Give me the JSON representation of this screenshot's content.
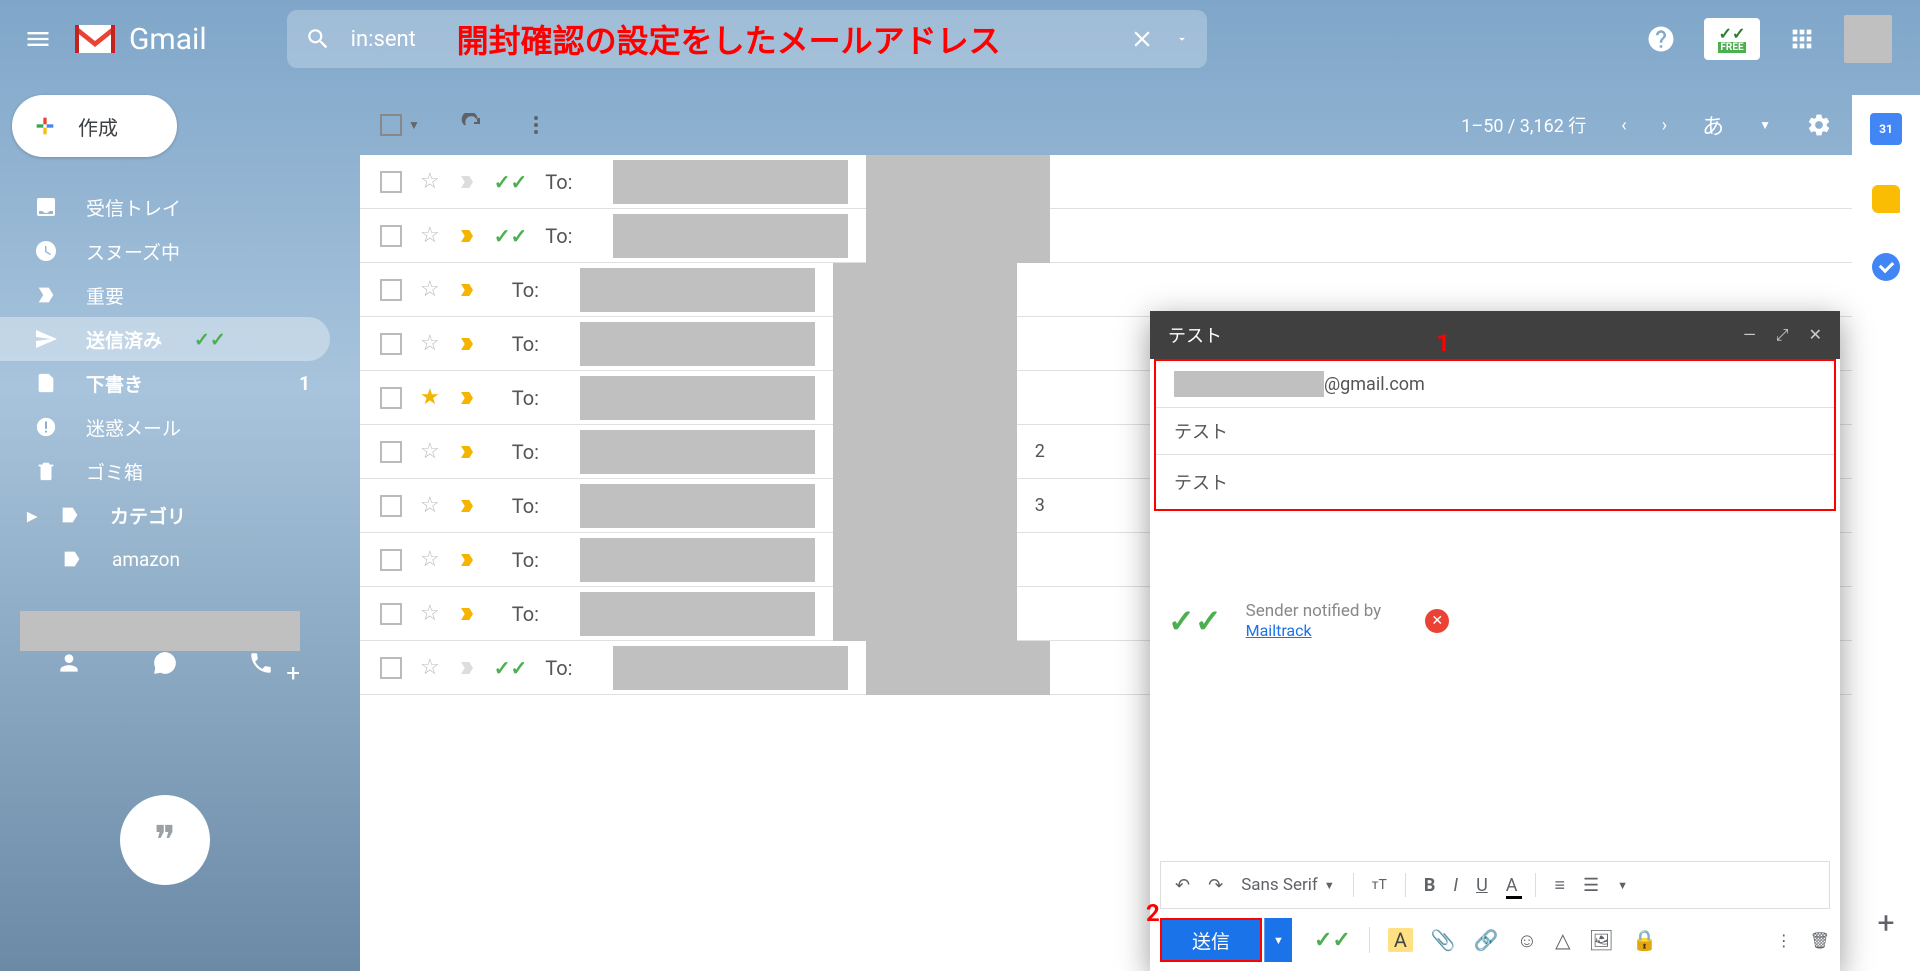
{
  "header": {
    "logo_text": "Gmail",
    "search_value": "in:sent",
    "annotation": "開封確認の設定をしたメールアドレス",
    "mailtrack_free": "FREE"
  },
  "compose_btn": "作成",
  "sidebar": {
    "items": [
      {
        "label": "受信トレイ",
        "icon": "inbox"
      },
      {
        "label": "スヌーズ中",
        "icon": "snooze"
      },
      {
        "label": "重要",
        "icon": "important"
      },
      {
        "label": "送信済み",
        "icon": "send",
        "active": true
      },
      {
        "label": "下書き",
        "icon": "draft",
        "count": "1"
      },
      {
        "label": "迷惑メール",
        "icon": "spam"
      },
      {
        "label": "ゴミ箱",
        "icon": "trash"
      },
      {
        "label": "カテゴリ",
        "icon": "category"
      },
      {
        "label": "amazon",
        "icon": "label"
      }
    ]
  },
  "toolbar": {
    "pagination": "1–50 / 3,162 行",
    "ime": "あ"
  },
  "emails": [
    {
      "to": "To:",
      "track": "green",
      "imp": "gray",
      "star": ""
    },
    {
      "to": "To:",
      "track": "green",
      "imp": "yellow",
      "star": ""
    },
    {
      "to": "To:",
      "track": "",
      "imp": "yellow",
      "star": ""
    },
    {
      "to": "To:",
      "track": "",
      "imp": "yellow",
      "star": ""
    },
    {
      "to": "To:",
      "track": "",
      "imp": "yellow",
      "star": "gold"
    },
    {
      "to": "To:",
      "track": "",
      "imp": "yellow",
      "star": "",
      "num": "2"
    },
    {
      "to": "To:",
      "track": "",
      "imp": "yellow",
      "star": "",
      "num": "3"
    },
    {
      "to": "To:",
      "track": "",
      "imp": "yellow",
      "star": ""
    },
    {
      "to": "To:",
      "track": "",
      "imp": "yellow",
      "star": ""
    },
    {
      "to": "To:",
      "track": "green",
      "imp": "gray",
      "star": ""
    }
  ],
  "compose": {
    "title": "テスト",
    "to_domain": "@gmail.com",
    "subject": "テスト",
    "body": "テスト",
    "notif_text": "Sender notified by",
    "notif_link": "Mailtrack",
    "font": "Sans Serif",
    "send": "送信",
    "marker1": "1",
    "marker2": "2"
  },
  "right_panel": {
    "calendar_day": "31"
  }
}
